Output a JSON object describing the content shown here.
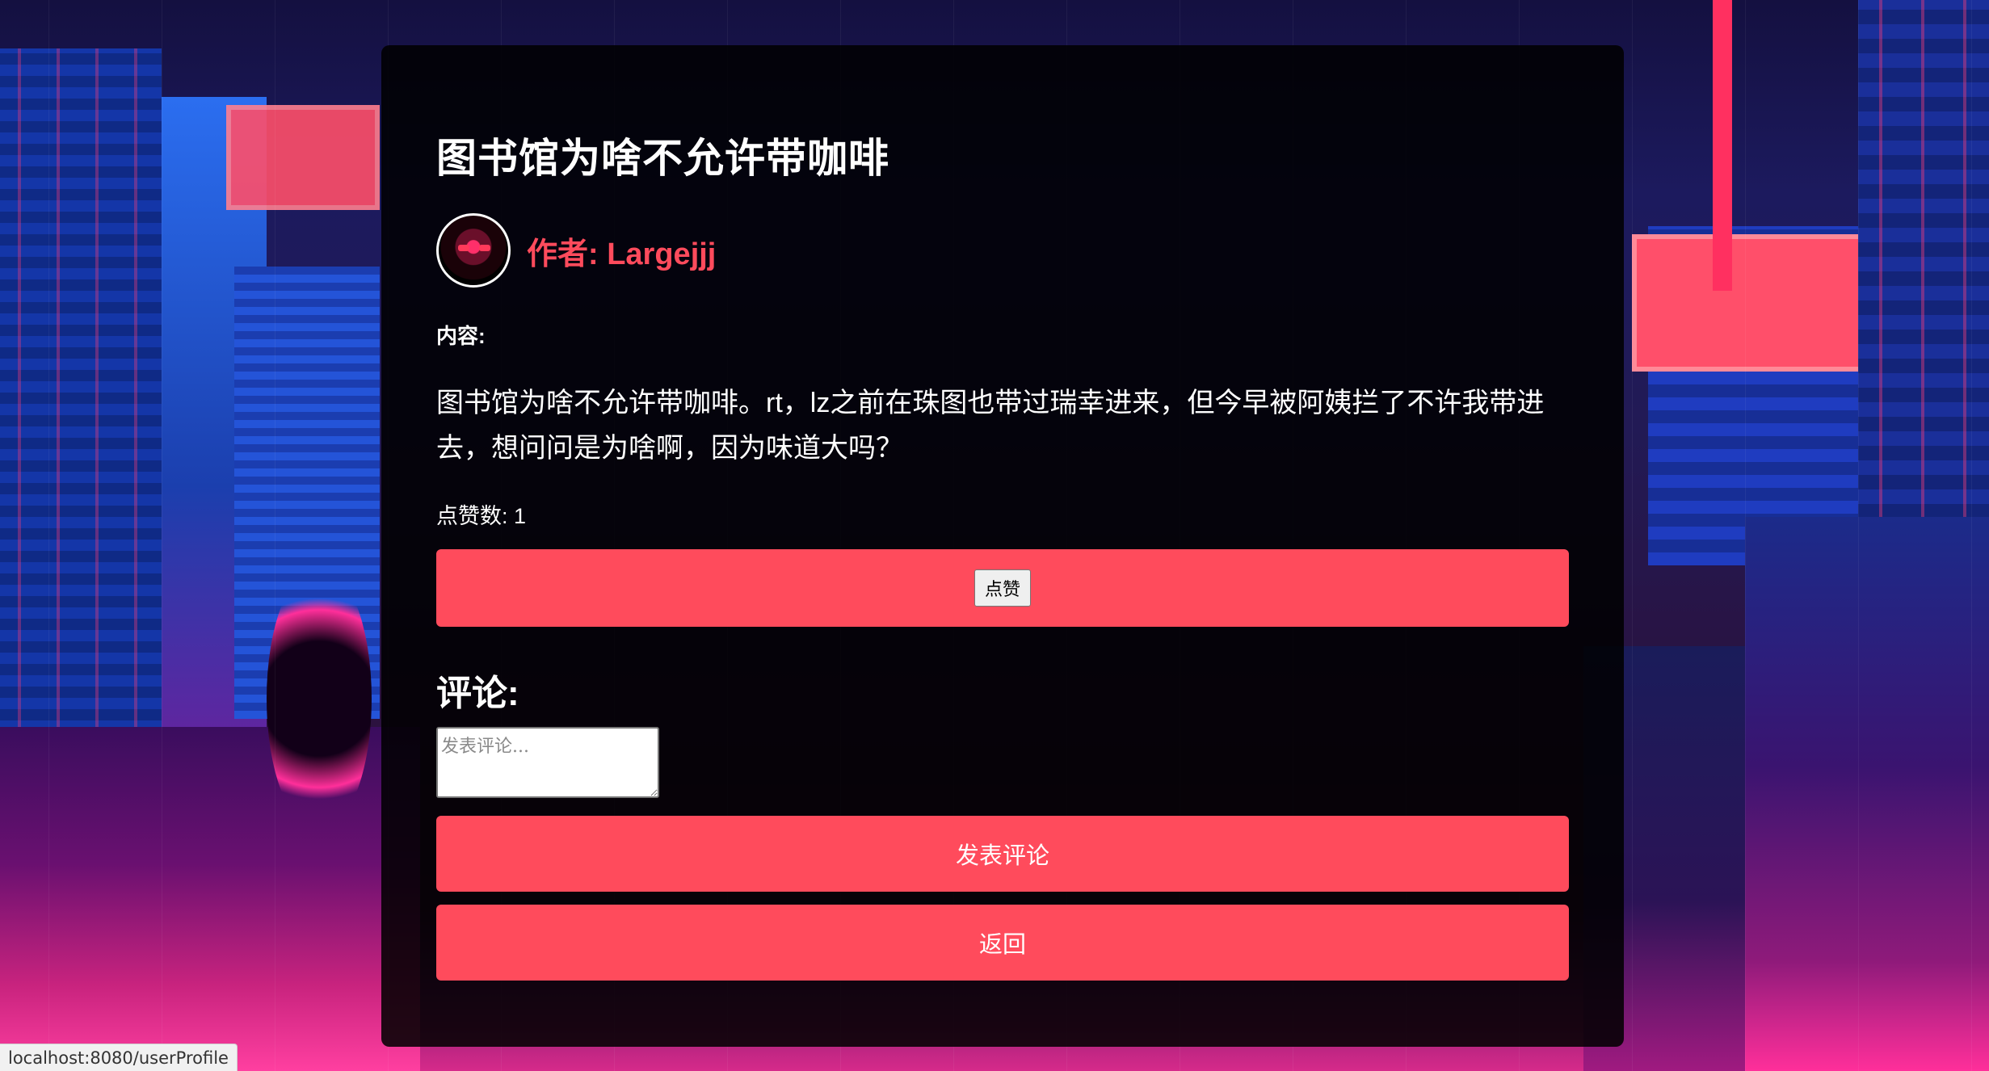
{
  "post": {
    "title": "图书馆为啥不允许带咖啡",
    "author_label": "作者: Largejjj",
    "content_label": "内容:",
    "body": "图书馆为啥不允许带咖啡。rt，lz之前在珠图也带过瑞幸进来，但今早被阿姨拦了不许我带进去，想问问是为啥啊，因为味道大吗？",
    "likes_text": "点赞数: 1",
    "like_button": "点赞"
  },
  "comments": {
    "title": "评论:",
    "input_placeholder": "发表评论...",
    "submit_button": "发表评论",
    "back_button": "返回"
  },
  "status_bar": {
    "url": "localhost:8080/userProfile"
  },
  "colors": {
    "accent": "#ff4b5c",
    "panel": "rgba(0,0,0,0.86)",
    "text": "#ffffff"
  },
  "icons": {
    "avatar": "author-avatar"
  }
}
